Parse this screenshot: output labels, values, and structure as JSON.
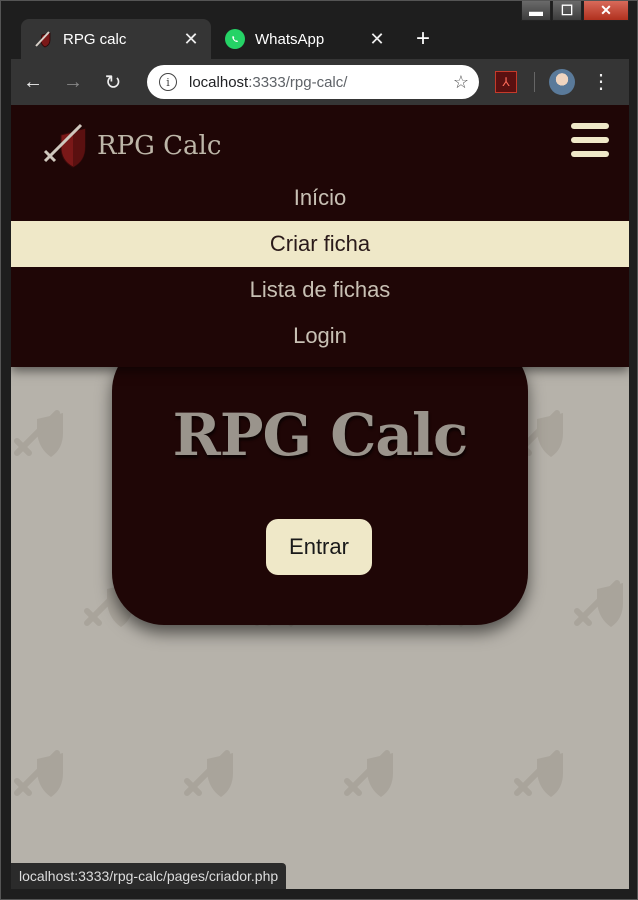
{
  "window": {
    "controls": {
      "minimize": "▬",
      "maximize": "☐",
      "close": "✕"
    }
  },
  "tabs": [
    {
      "title": "RPG calc",
      "close": "✕",
      "icon": "rpg-calc-favicon"
    },
    {
      "title": "WhatsApp",
      "close": "✕",
      "icon": "whatsapp-icon"
    }
  ],
  "toolbar": {
    "new_tab": "+",
    "back": "←",
    "forward": "→",
    "reload": "↻",
    "info": "i",
    "url_host": "localhost",
    "url_path": ":3333/rpg-calc/",
    "bookmark": "☆",
    "pdf_ext": "⅄",
    "menu": "⋮"
  },
  "site": {
    "logo_text": "RPG Calc",
    "nav": [
      {
        "label": "Início",
        "active": false
      },
      {
        "label": "Criar ficha",
        "active": true
      },
      {
        "label": "Lista de fichas",
        "active": false
      },
      {
        "label": "Login",
        "active": false
      }
    ],
    "card_title": "RPG Calc",
    "enter_button": "Entrar"
  },
  "status_bar": "localhost:3333/rpg-calc/pages/criador.php",
  "colors": {
    "header_bg": "#1f0606",
    "accent_cream": "#efe8c8",
    "page_bg": "#b6b2aa"
  }
}
